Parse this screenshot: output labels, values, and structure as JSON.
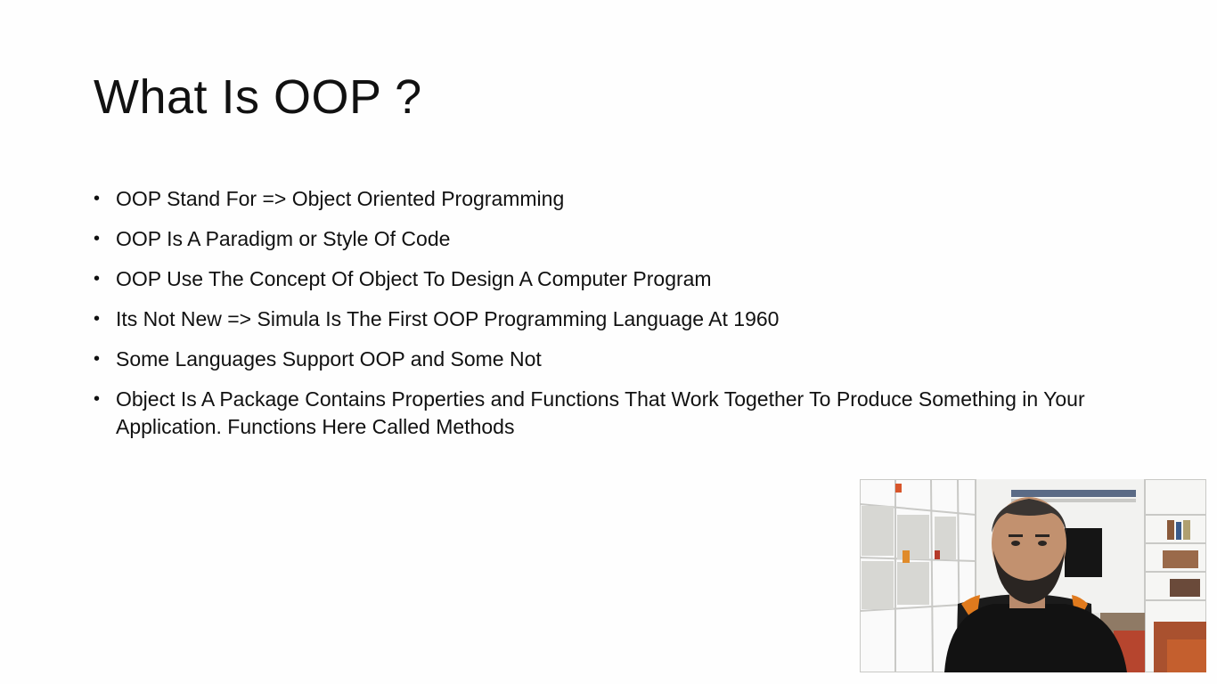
{
  "slide": {
    "title": "What Is OOP ?",
    "bullets": [
      "OOP Stand For => Object Oriented Programming",
      "OOP Is A Paradigm or Style Of Code",
      "OOP Use The Concept Of Object To Design A Computer Program",
      "Its Not New => Simula Is The First OOP Programming Language At 1960",
      "Some Languages Support OOP and Some Not",
      "Object Is A Package Contains Properties and Functions That Work Together To Produce Something in Your Application. Functions Here Called Methods"
    ],
    "bullet_glyph": "•"
  },
  "webcam": {
    "icon": "presenter-video-feed"
  }
}
